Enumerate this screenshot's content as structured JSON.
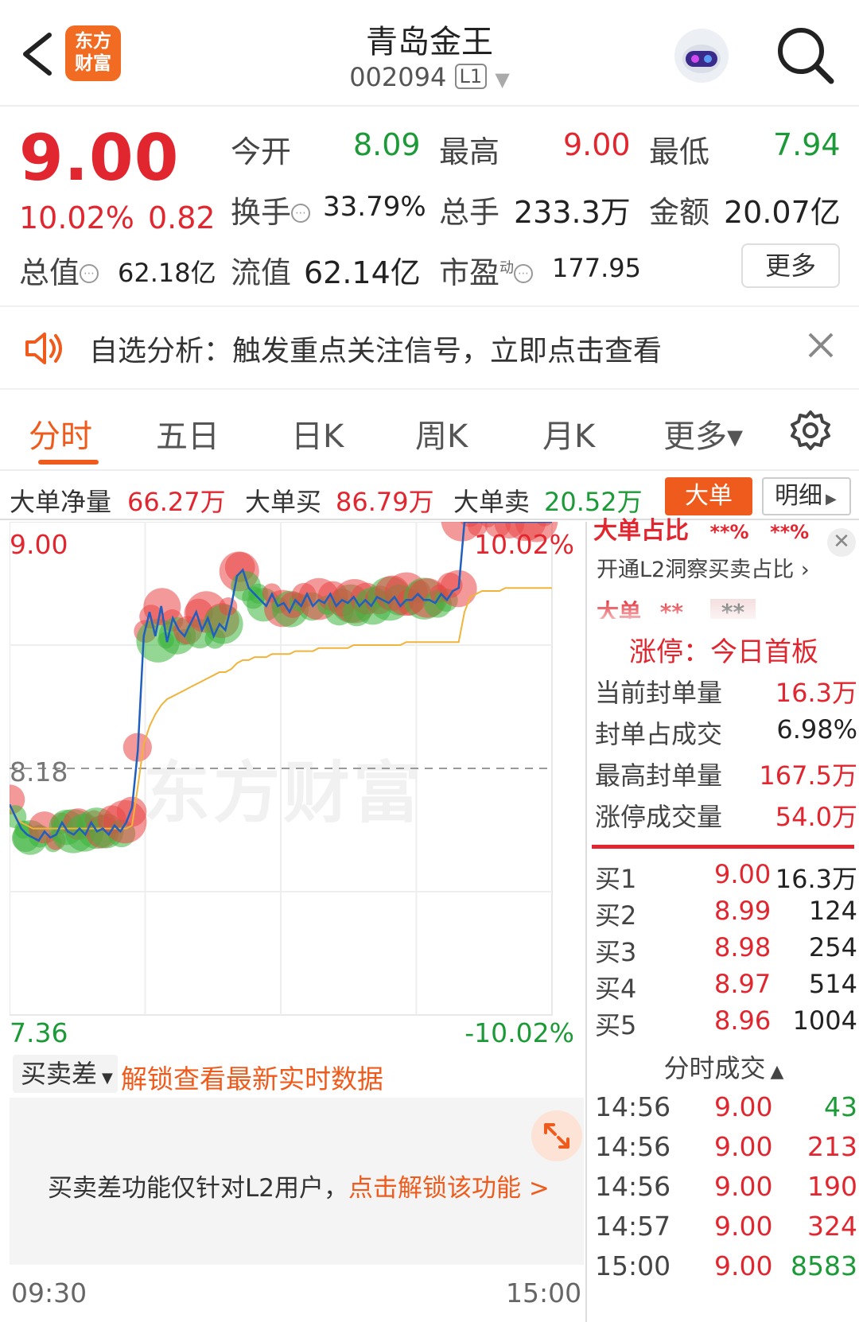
{
  "header": {
    "logo_line1": "东方",
    "logo_line2": "财富",
    "title": "青岛金王",
    "code": "002094",
    "badge": "L1"
  },
  "quote": {
    "price": "9.00",
    "change_pct": "10.02%",
    "change_abs": "0.82",
    "open_label": "今开",
    "open_value": "8.09",
    "high_label": "最高",
    "high_value": "9.00",
    "low_label": "最低",
    "low_value": "7.94",
    "turnover_label": "换手",
    "turnover_value": "33.79%",
    "volume_label": "总手",
    "volume_value": "233.3万",
    "amount_label": "金额",
    "amount_value": "20.07亿",
    "mktcap_label": "总值",
    "mktcap_value": "62.18亿",
    "float_label": "流值",
    "float_value": "62.14亿",
    "pe_label": "市盈",
    "pe_sup": "动",
    "pe_value": "177.95",
    "more_button": "更多"
  },
  "alert": {
    "text": "自选分析：触发重点关注信号，立即点击查看"
  },
  "tabs": [
    "分时",
    "五日",
    "日K",
    "周K",
    "月K",
    "更多▾"
  ],
  "bigorder": {
    "net_label": "大单净量",
    "net_value": "66.27万",
    "buy_label": "大单买",
    "buy_value": "86.79万",
    "sell_label": "大单卖",
    "sell_value": "20.52万",
    "bigorder_button": "大单",
    "detail_button": "明细"
  },
  "chart_labels": {
    "top_price": "9.00",
    "top_pct": "10.02%",
    "mid_price": "8.18",
    "bottom_price": "7.36",
    "bottom_pct": "-10.02%",
    "watermark": "东方财富"
  },
  "chart_data": {
    "type": "line",
    "ylim": [
      7.36,
      9.0
    ],
    "reference": 8.18,
    "x_start": "09:30",
    "x_end": "15:00",
    "series": [
      {
        "values": [
          8.06,
          8.02,
          7.98,
          7.96,
          7.95,
          7.94,
          7.97,
          7.95,
          7.96,
          8.0,
          7.97,
          7.96,
          7.98,
          7.96,
          8.0,
          7.97,
          7.98,
          7.96,
          7.99,
          7.97,
          8.0,
          8.05,
          8.24,
          8.62,
          8.7,
          8.62,
          8.72,
          8.6,
          8.68,
          8.64,
          8.62,
          8.66,
          8.7,
          8.64,
          8.68,
          8.62,
          8.66,
          8.64,
          8.72,
          8.82,
          8.84,
          8.78,
          8.76,
          8.74,
          8.72,
          8.76,
          8.72,
          8.73,
          8.7,
          8.74,
          8.72,
          8.76,
          8.72,
          8.74,
          8.73,
          8.76,
          8.72,
          8.74,
          8.73,
          8.75,
          8.72,
          8.74,
          8.72,
          8.75,
          8.74,
          8.73,
          8.75,
          8.72,
          8.74,
          8.74,
          8.76,
          8.74,
          8.74,
          8.73,
          8.76,
          8.74,
          8.77,
          8.78,
          9.0,
          9.0,
          9.0,
          9.0,
          9.0,
          9.0,
          9.0,
          9.0,
          9.0,
          9.0,
          9.0,
          9.0,
          9.0,
          9.0,
          9.0,
          9.0
        ]
      },
      {
        "values": [
          8.05,
          8.02,
          8.0,
          7.99,
          7.98,
          7.98,
          7.98,
          7.98,
          7.98,
          7.98,
          7.98,
          7.98,
          7.98,
          7.98,
          7.98,
          7.98,
          7.98,
          7.98,
          7.98,
          7.98,
          7.98,
          7.99,
          8.12,
          8.26,
          8.32,
          8.36,
          8.39,
          8.41,
          8.42,
          8.43,
          8.44,
          8.45,
          8.46,
          8.47,
          8.48,
          8.49,
          8.5,
          8.5,
          8.51,
          8.53,
          8.54,
          8.54,
          8.55,
          8.55,
          8.55,
          8.56,
          8.56,
          8.56,
          8.56,
          8.57,
          8.57,
          8.57,
          8.57,
          8.58,
          8.58,
          8.58,
          8.58,
          8.58,
          8.58,
          8.59,
          8.59,
          8.59,
          8.59,
          8.59,
          8.59,
          8.59,
          8.59,
          8.59,
          8.6,
          8.6,
          8.6,
          8.6,
          8.6,
          8.6,
          8.6,
          8.6,
          8.6,
          8.6,
          8.7,
          8.75,
          8.76,
          8.77,
          8.77,
          8.77,
          8.77,
          8.78,
          8.78,
          8.78,
          8.78,
          8.78,
          8.78,
          8.78,
          8.78,
          8.78
        ]
      }
    ],
    "grid": true
  },
  "right_panel": {
    "partial_header": "大单占比",
    "partial_pct1": "**%",
    "partial_pct2": "**%",
    "l2_link": "开通L2洞察买卖占比",
    "partial_label": "大单",
    "partial_v1": "**",
    "partial_v2": "**",
    "limit_title": "涨停：今日首板",
    "limit_rows": [
      {
        "label": "当前封单量",
        "value": "16.3万"
      },
      {
        "label": "封单占成交",
        "value": "6.98%"
      },
      {
        "label": "最高封单量",
        "value": "167.5万"
      },
      {
        "label": "涨停成交量",
        "value": "54.0万"
      }
    ],
    "bids": [
      {
        "label": "买1",
        "price": "9.00",
        "vol": "16.3万"
      },
      {
        "label": "买2",
        "price": "8.99",
        "vol": "124"
      },
      {
        "label": "买3",
        "price": "8.98",
        "vol": "254"
      },
      {
        "label": "买4",
        "price": "8.97",
        "vol": "514"
      },
      {
        "label": "买5",
        "price": "8.96",
        "vol": "1004"
      }
    ],
    "ticks_title": "分时成交",
    "ticks": [
      {
        "time": "14:56",
        "price": "9.00",
        "vol": "43"
      },
      {
        "time": "14:56",
        "price": "9.00",
        "vol": "213"
      },
      {
        "time": "14:56",
        "price": "9.00",
        "vol": "190"
      },
      {
        "time": "14:57",
        "price": "9.00",
        "vol": "324"
      },
      {
        "time": "15:00",
        "price": "9.00",
        "vol": "8583"
      }
    ]
  },
  "indicator": {
    "select_label": "买卖差",
    "unlock_text": "解锁查看最新实时数据",
    "locked_text": "买卖差功能仅针对L2用户，",
    "locked_link": "点击解锁该功能 >"
  },
  "colors": {
    "accent": "#ef5b1c",
    "up": "#e2262f",
    "down": "#1c9a37",
    "price_line": "#1f5fbf",
    "avg_line": "#f0b43a"
  }
}
